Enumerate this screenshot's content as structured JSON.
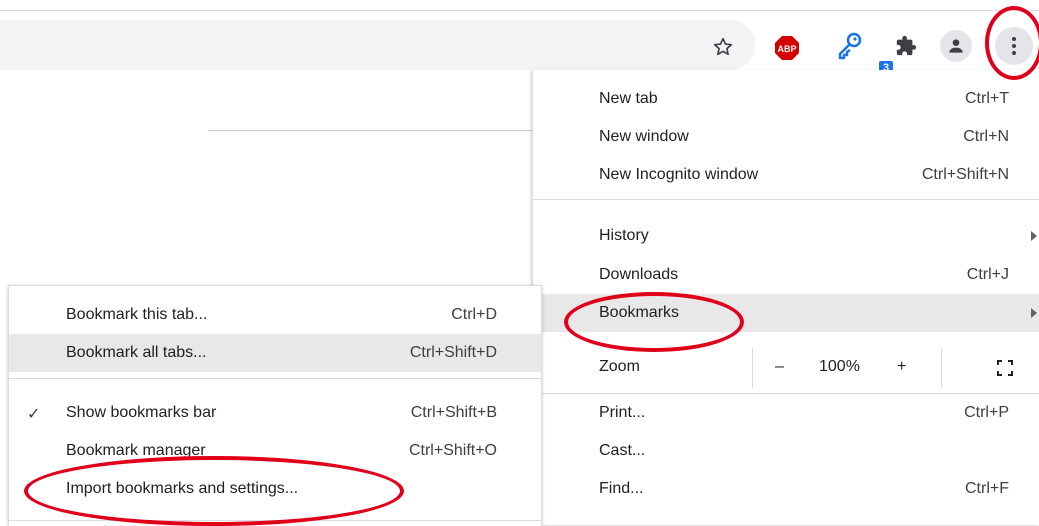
{
  "toolbar": {
    "star_icon": "star-outline-icon",
    "abp_label": "ABP",
    "key_badge": "3",
    "accent": "#1a73e8",
    "abp_color": "#d50000"
  },
  "menu": {
    "new_tab": {
      "label": "New tab",
      "shortcut": "Ctrl+T"
    },
    "new_window": {
      "label": "New window",
      "shortcut": "Ctrl+N"
    },
    "new_incognito": {
      "label": "New Incognito window",
      "shortcut": "Ctrl+Shift+N"
    },
    "history": {
      "label": "History"
    },
    "downloads": {
      "label": "Downloads",
      "shortcut": "Ctrl+J"
    },
    "bookmarks": {
      "label": "Bookmarks"
    },
    "zoom": {
      "label": "Zoom",
      "minus": "–",
      "value": "100%",
      "plus": "+"
    },
    "print": {
      "label": "Print...",
      "shortcut": "Ctrl+P"
    },
    "cast": {
      "label": "Cast..."
    },
    "find": {
      "label": "Find...",
      "shortcut": "Ctrl+F"
    }
  },
  "submenu": {
    "bookmark_tab": {
      "label": "Bookmark this tab...",
      "shortcut": "Ctrl+D"
    },
    "bookmark_all": {
      "label": "Bookmark all tabs...",
      "shortcut": "Ctrl+Shift+D"
    },
    "show_bar": {
      "check": "✓",
      "label": "Show bookmarks bar",
      "shortcut": "Ctrl+Shift+B"
    },
    "manager": {
      "label": "Bookmark manager",
      "shortcut": "Ctrl+Shift+O"
    },
    "import": {
      "label": "Import bookmarks and settings..."
    }
  },
  "annotation_color": "#e0001a"
}
